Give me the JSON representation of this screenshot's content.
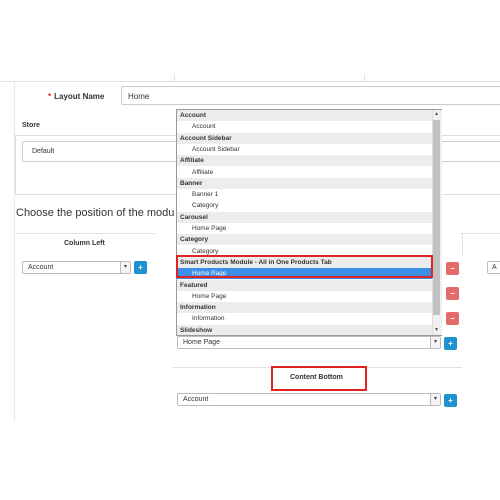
{
  "layout": {
    "label": "Layout Name",
    "required_mark": "*",
    "value": "Home"
  },
  "store": {
    "label": "Store",
    "value": "Default"
  },
  "position_title": "Choose the position of the modu",
  "column_left": {
    "title": "Column Left",
    "select_value": "Account",
    "add_symbol": "+"
  },
  "content_top_select_value": "Home Page",
  "delete_symbol": "−",
  "right_select_value": "A",
  "content_bottom": {
    "title": "Content Bottom",
    "select_value": "Account",
    "add_symbol": "+"
  },
  "dropdown": {
    "rows": [
      {
        "type": "group",
        "label": "Account"
      },
      {
        "type": "item",
        "label": "Account"
      },
      {
        "type": "group",
        "label": "Account Sidebar"
      },
      {
        "type": "item",
        "label": "Account Sidebar"
      },
      {
        "type": "group",
        "label": "Affiliate"
      },
      {
        "type": "item",
        "label": "Affiliate"
      },
      {
        "type": "group",
        "label": "Banner"
      },
      {
        "type": "item",
        "label": "Banner 1"
      },
      {
        "type": "item",
        "label": "Category"
      },
      {
        "type": "group",
        "label": "Carousel"
      },
      {
        "type": "item",
        "label": "Home Page"
      },
      {
        "type": "group",
        "label": "Category"
      },
      {
        "type": "item",
        "label": "Category"
      },
      {
        "type": "group",
        "label": "Smart Products Module - All in One Products Tab"
      },
      {
        "type": "item",
        "label": "Home Page",
        "selected": true
      },
      {
        "type": "group",
        "label": "Featured"
      },
      {
        "type": "item",
        "label": "Home Page"
      },
      {
        "type": "group",
        "label": "Information"
      },
      {
        "type": "item",
        "label": "Information"
      },
      {
        "type": "group",
        "label": "Slideshow"
      }
    ]
  },
  "colors": {
    "accent": "#1e91cf",
    "danger": "#e56b6b",
    "highlight": "#e02424",
    "selected": "#3b8fe6"
  }
}
